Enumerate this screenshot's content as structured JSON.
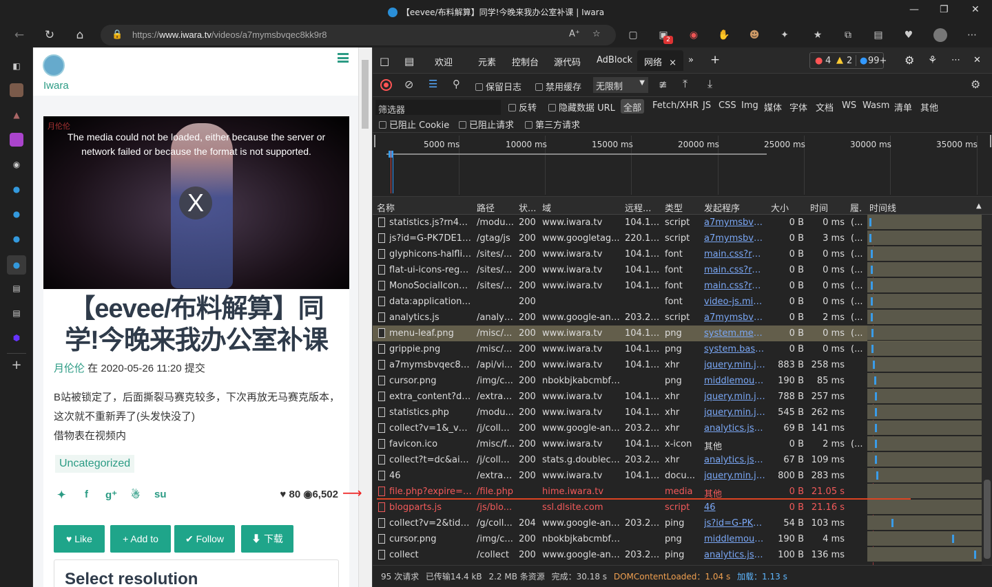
{
  "window": {
    "title": "【eevee/布料解算】同学!今晚来我办公室补课 | Iwara"
  },
  "address": {
    "url_prefix": "https://",
    "url_host": "www.iwara.tv",
    "url_path": "/videos/a7mymsbvqec8kk9r8"
  },
  "extensions": {
    "notification_count": "2"
  },
  "page": {
    "site_name": "Iwara",
    "watermark": "月伦伦",
    "video_error": "The media could not be loaded, either because the server or network failed or because the format is not supported.",
    "close_glyph": "X",
    "title": "【eevee/布料解算】同学!今晚来我办公室补课",
    "author": "月伦伦",
    "date_text": " 在 2020-05-26 11:20 提交",
    "desc_line1": "B站被锁定了，后面撕裂马赛克较多，下次再放无马赛克版本，这次就不重新弄了(头发快没了)",
    "desc_line2": "借物表在视频内",
    "tag": "Uncategorized",
    "likes": "80",
    "views": "6,502",
    "buttons": {
      "like": "Like",
      "add": "Add to",
      "follow": "Follow",
      "download": "下载"
    },
    "resolution_heading": "Select resolution"
  },
  "devtools": {
    "tabs": [
      "欢迎",
      "元素",
      "控制台",
      "源代码",
      "AdBlock",
      "网络"
    ],
    "errors": "4",
    "warnings": "2",
    "messages": "99+",
    "toolbar": {
      "preserve_log": "保留日志",
      "disable_cache": "禁用缓存",
      "throttle": "无限制"
    },
    "filter": {
      "placeholder": "筛选器",
      "invert": "反转",
      "hide_data_urls": "隐藏数据 URL",
      "types": [
        "全部",
        "Fetch/XHR",
        "JS",
        "CSS",
        "Img",
        "媒体",
        "字体",
        "文档",
        "WS",
        "Wasm",
        "清单",
        "其他"
      ],
      "blocked_cookies": "已阻止 Cookie",
      "blocked_requests": "已阻止请求",
      "third_party": "第三方请求"
    },
    "timeline_labels": [
      "5000 ms",
      "10000 ms",
      "15000 ms",
      "20000 ms",
      "25000 ms",
      "30000 ms",
      "35000 ms"
    ],
    "columns": [
      "名称",
      "路径",
      "状...",
      "域",
      "远程...",
      "类型",
      "发起程序",
      "大小",
      "时间",
      "履.",
      "时间线"
    ],
    "rows": [
      {
        "name": "statistics.js?rn4y0z",
        "path": "/modu...",
        "status": "200",
        "domain": "www.iwara.tv",
        "remote": "104.19...",
        "type": "script",
        "initiator": "a7mymsbvq...",
        "size": "0 B",
        "time": "0 ms",
        "p": "(...",
        "wf": 0.02
      },
      {
        "name": "js?id=G-PK7DE1R...",
        "path": "/gtag/js",
        "status": "200",
        "domain": "www.googletag...",
        "remote": "220.18...",
        "type": "script",
        "initiator": "a7mymsbvq...",
        "size": "0 B",
        "time": "3 ms",
        "p": "(...",
        "wf": 0.02
      },
      {
        "name": "glyphicons-halflin...",
        "path": "/sites/...",
        "status": "200",
        "domain": "www.iwara.tv",
        "remote": "104.19...",
        "type": "font",
        "initiator": "main.css?rn4...",
        "size": "0 B",
        "time": "0 ms",
        "p": "(...",
        "wf": 0.03
      },
      {
        "name": "flat-ui-icons-regul...",
        "path": "/sites/...",
        "status": "200",
        "domain": "www.iwara.tv",
        "remote": "104.19...",
        "type": "font",
        "initiator": "main.css?rn4...",
        "size": "0 B",
        "time": "0 ms",
        "p": "(...",
        "wf": 0.03
      },
      {
        "name": "MonoSocialIconsF...",
        "path": "/sites/...",
        "status": "200",
        "domain": "www.iwara.tv",
        "remote": "104.19...",
        "type": "font",
        "initiator": "main.css?rn4...",
        "size": "0 B",
        "time": "0 ms",
        "p": "(...",
        "wf": 0.03
      },
      {
        "name": "data:application/f...",
        "path": "",
        "status": "200",
        "domain": "",
        "remote": "",
        "type": "font",
        "initiator": "video-js.min....",
        "size": "0 B",
        "time": "0 ms",
        "p": "(...",
        "wf": 0.03
      },
      {
        "name": "analytics.js",
        "path": "/analyt...",
        "status": "200",
        "domain": "www.google-ana...",
        "remote": "203.20...",
        "type": "script",
        "initiator": "a7mymsbvq...",
        "size": "0 B",
        "time": "2 ms",
        "p": "(...",
        "wf": 0.03
      },
      {
        "name": "menu-leaf.png",
        "path": "/misc/...",
        "status": "200",
        "domain": "www.iwara.tv",
        "remote": "104.19...",
        "type": "png",
        "initiator": "system.menu...",
        "size": "0 B",
        "time": "0 ms",
        "p": "(...",
        "wf": 0.04,
        "selected": true
      },
      {
        "name": "grippie.png",
        "path": "/misc/...",
        "status": "200",
        "domain": "www.iwara.tv",
        "remote": "104.19...",
        "type": "png",
        "initiator": "system.base....",
        "size": "0 B",
        "time": "0 ms",
        "p": "(...",
        "wf": 0.04
      },
      {
        "name": "a7mymsbvqec8kk...",
        "path": "/api/vi...",
        "status": "200",
        "domain": "www.iwara.tv",
        "remote": "104.19...",
        "type": "xhr",
        "initiator": "jquery.min.js:6",
        "size": "883 B",
        "time": "258 ms",
        "p": "",
        "wf": 0.05
      },
      {
        "name": "cursor.png",
        "path": "/img/c...",
        "status": "200",
        "domain": "nbokbjkabcmbfd...",
        "remote": "",
        "type": "png",
        "initiator": "middlemous...",
        "size": "190 B",
        "time": "85 ms",
        "p": "",
        "wf": 0.06
      },
      {
        "name": "extra_content?de...",
        "path": "/extra_...",
        "status": "200",
        "domain": "www.iwara.tv",
        "remote": "104.19...",
        "type": "xhr",
        "initiator": "jquery.min.js:6",
        "size": "788 B",
        "time": "257 ms",
        "p": "",
        "wf": 0.07
      },
      {
        "name": "statistics.php",
        "path": "/modu...",
        "status": "200",
        "domain": "www.iwara.tv",
        "remote": "104.19...",
        "type": "xhr",
        "initiator": "jquery.min.js:6",
        "size": "545 B",
        "time": "262 ms",
        "p": "",
        "wf": 0.07
      },
      {
        "name": "collect?v=1&_v=j...",
        "path": "/j/colle...",
        "status": "200",
        "domain": "www.google-ana...",
        "remote": "203.20...",
        "type": "xhr",
        "initiator": "analytics.js:43",
        "size": "69 B",
        "time": "141 ms",
        "p": "",
        "wf": 0.07
      },
      {
        "name": "favicon.ico",
        "path": "/misc/f...",
        "status": "200",
        "domain": "www.iwara.tv",
        "remote": "104.19...",
        "type": "x-icon",
        "initiator": "其他",
        "size": "0 B",
        "time": "2 ms",
        "p": "(...",
        "wf": 0.07,
        "plain_init": true
      },
      {
        "name": "collect?t=dc&aip...",
        "path": "/j/colle...",
        "status": "200",
        "domain": "stats.g.doubleclic...",
        "remote": "203.20...",
        "type": "xhr",
        "initiator": "analytics.js:43",
        "size": "67 B",
        "time": "109 ms",
        "p": "",
        "wf": 0.07
      },
      {
        "name": "46",
        "path": "/extra_...",
        "status": "200",
        "domain": "www.iwara.tv",
        "remote": "104.19...",
        "type": "docu...",
        "initiator": "jquery.min.js:5",
        "size": "800 B",
        "time": "283 ms",
        "p": "",
        "wf": 0.08
      },
      {
        "name": "file.php?expire=1...",
        "path": "/file.php",
        "status": "",
        "domain": "hime.iwara.tv",
        "remote": "",
        "type": "media",
        "initiator": "其他",
        "size": "0 B",
        "time": "21.05 s",
        "p": "",
        "wf": -1,
        "error": true,
        "plain_init": true
      },
      {
        "name": "blogparts.js",
        "path": "/js/blo...",
        "status": "",
        "domain": "ssl.dlsite.com",
        "remote": "",
        "type": "script",
        "initiator": "46",
        "size": "0 B",
        "time": "21.16 s",
        "p": "",
        "wf": -1,
        "error": true
      },
      {
        "name": "collect?v=2&tid=...",
        "path": "/g/coll...",
        "status": "204",
        "domain": "www.google-ana...",
        "remote": "203.20...",
        "type": "ping",
        "initiator": "js?id=G-PK7...",
        "size": "54 B",
        "time": "103 ms",
        "p": "",
        "wf": 0.22
      },
      {
        "name": "cursor.png",
        "path": "/img/c...",
        "status": "200",
        "domain": "nbokbjkabcmbfd...",
        "remote": "",
        "type": "png",
        "initiator": "middlemous...",
        "size": "190 B",
        "time": "4 ms",
        "p": "",
        "wf": 0.77
      },
      {
        "name": "collect",
        "path": "/collect",
        "status": "200",
        "domain": "www.google-ana...",
        "remote": "203.20...",
        "type": "ping",
        "initiator": "analytics.js:44",
        "size": "100 B",
        "time": "136 ms",
        "p": "",
        "wf": 0.97
      }
    ],
    "status_bar": {
      "requests": "95 次请求",
      "transferred": "已传输14.4 kB",
      "resources": "2.2 MB 条资源",
      "finish": "完成：30.18 s",
      "dcl": "DOMContentLoaded：1.04 s",
      "load": "加载：1.13 s"
    }
  }
}
